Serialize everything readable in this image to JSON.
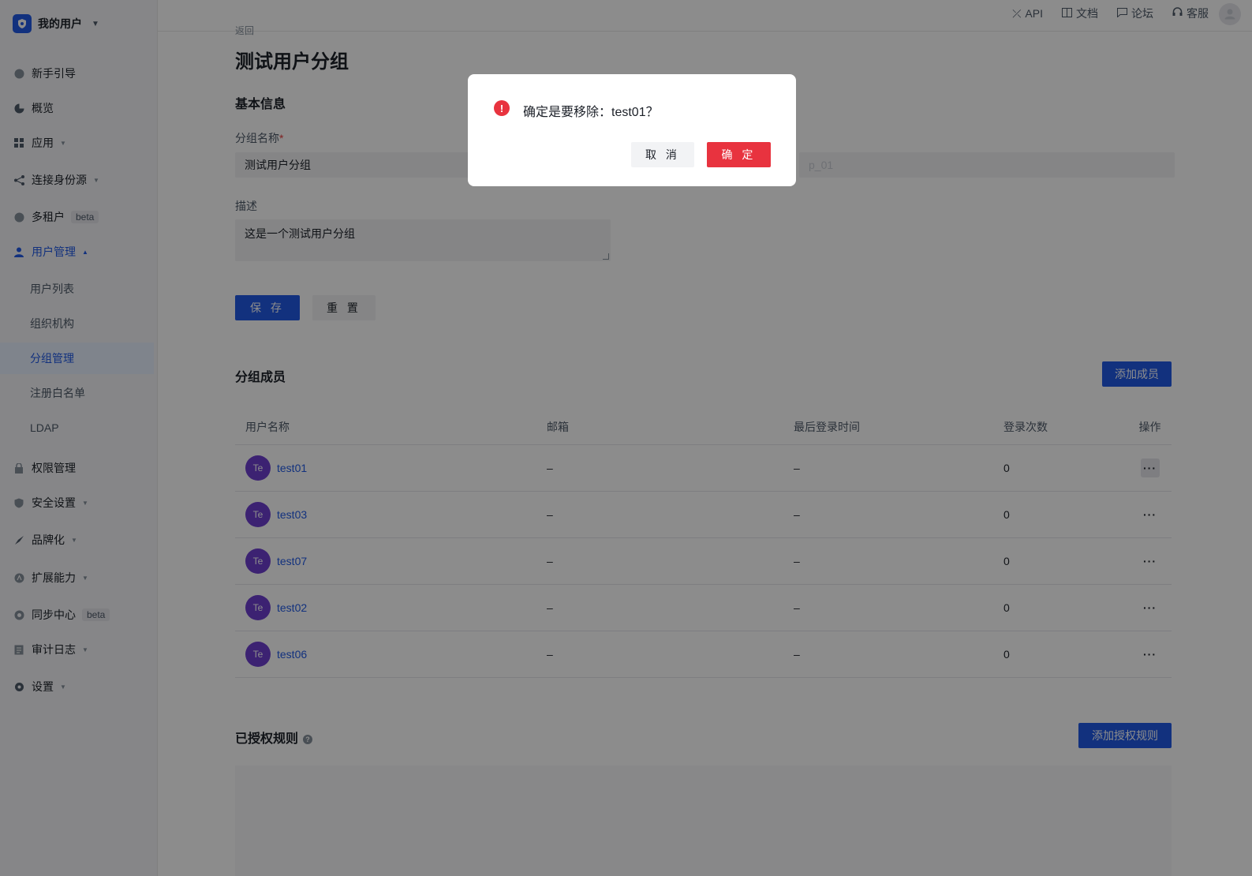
{
  "brand": {
    "name": "我的用户",
    "logo_icon": "shield-icon"
  },
  "topbar": {
    "links": [
      {
        "label": "API",
        "icon": "api-icon"
      },
      {
        "label": "文档",
        "icon": "book-icon"
      },
      {
        "label": "论坛",
        "icon": "chat-icon"
      },
      {
        "label": "客服",
        "icon": "headset-icon"
      }
    ]
  },
  "sidebar": {
    "items": [
      {
        "label": "新手引导",
        "icon": "guide-icon"
      },
      {
        "label": "概览",
        "icon": "pie-icon"
      },
      {
        "label": "应用",
        "icon": "grid-icon"
      },
      {
        "label": "连接身份源",
        "icon": "share-icon"
      },
      {
        "label": "多租户",
        "icon": "tenant-icon",
        "badge": "beta"
      },
      {
        "label": "用户管理",
        "icon": "users-icon"
      },
      {
        "label": "权限管理",
        "icon": "lock-icon"
      },
      {
        "label": "安全设置",
        "icon": "shield-icon"
      },
      {
        "label": "品牌化",
        "icon": "brush-icon"
      },
      {
        "label": "扩展能力",
        "icon": "extend-icon"
      },
      {
        "label": "同步中心",
        "icon": "sync-icon",
        "badge": "beta"
      },
      {
        "label": "审计日志",
        "icon": "log-icon"
      },
      {
        "label": "设置",
        "icon": "gear-icon"
      }
    ],
    "sub_items": [
      "用户列表",
      "组织机构",
      "分组管理",
      "注册白名单",
      "LDAP"
    ]
  },
  "main": {
    "back": "返回",
    "title": "测试用户分组",
    "basic_info_title": "基本信息",
    "group_name_label": "分组名称",
    "required_mark": "*",
    "group_name_value": "测试用户分组",
    "group_code_value": "p_01",
    "description_label": "描述",
    "description_value": "这是一个测试用户分组",
    "save_label": "保 存",
    "reset_label": "重 置",
    "members_title": "分组成员",
    "add_member_label": "添加成员",
    "table": {
      "headers": [
        "用户名称",
        "邮箱",
        "最后登录时间",
        "登录次数",
        "操作"
      ],
      "rows": [
        {
          "avatar": "Te",
          "name": "test01",
          "email": "–",
          "last_login": "–",
          "count": "0",
          "action": "···"
        },
        {
          "avatar": "Te",
          "name": "test03",
          "email": "–",
          "last_login": "–",
          "count": "0",
          "action": "···"
        },
        {
          "avatar": "Te",
          "name": "test07",
          "email": "–",
          "last_login": "–",
          "count": "0",
          "action": "···"
        },
        {
          "avatar": "Te",
          "name": "test02",
          "email": "–",
          "last_login": "–",
          "count": "0",
          "action": "···"
        },
        {
          "avatar": "Te",
          "name": "test06",
          "email": "–",
          "last_login": "–",
          "count": "0",
          "action": "···"
        }
      ]
    },
    "rules_title": "已授权规则",
    "help_mark": "?",
    "add_rule_label": "添加授权规则"
  },
  "modal": {
    "icon": "!",
    "message": "确定是要移除：test01？",
    "cancel_label": "取 消",
    "ok_label": "确 定"
  },
  "colors": {
    "primary": "#215ae5",
    "danger": "#e8333f",
    "avatar": "#6d3fcf"
  }
}
